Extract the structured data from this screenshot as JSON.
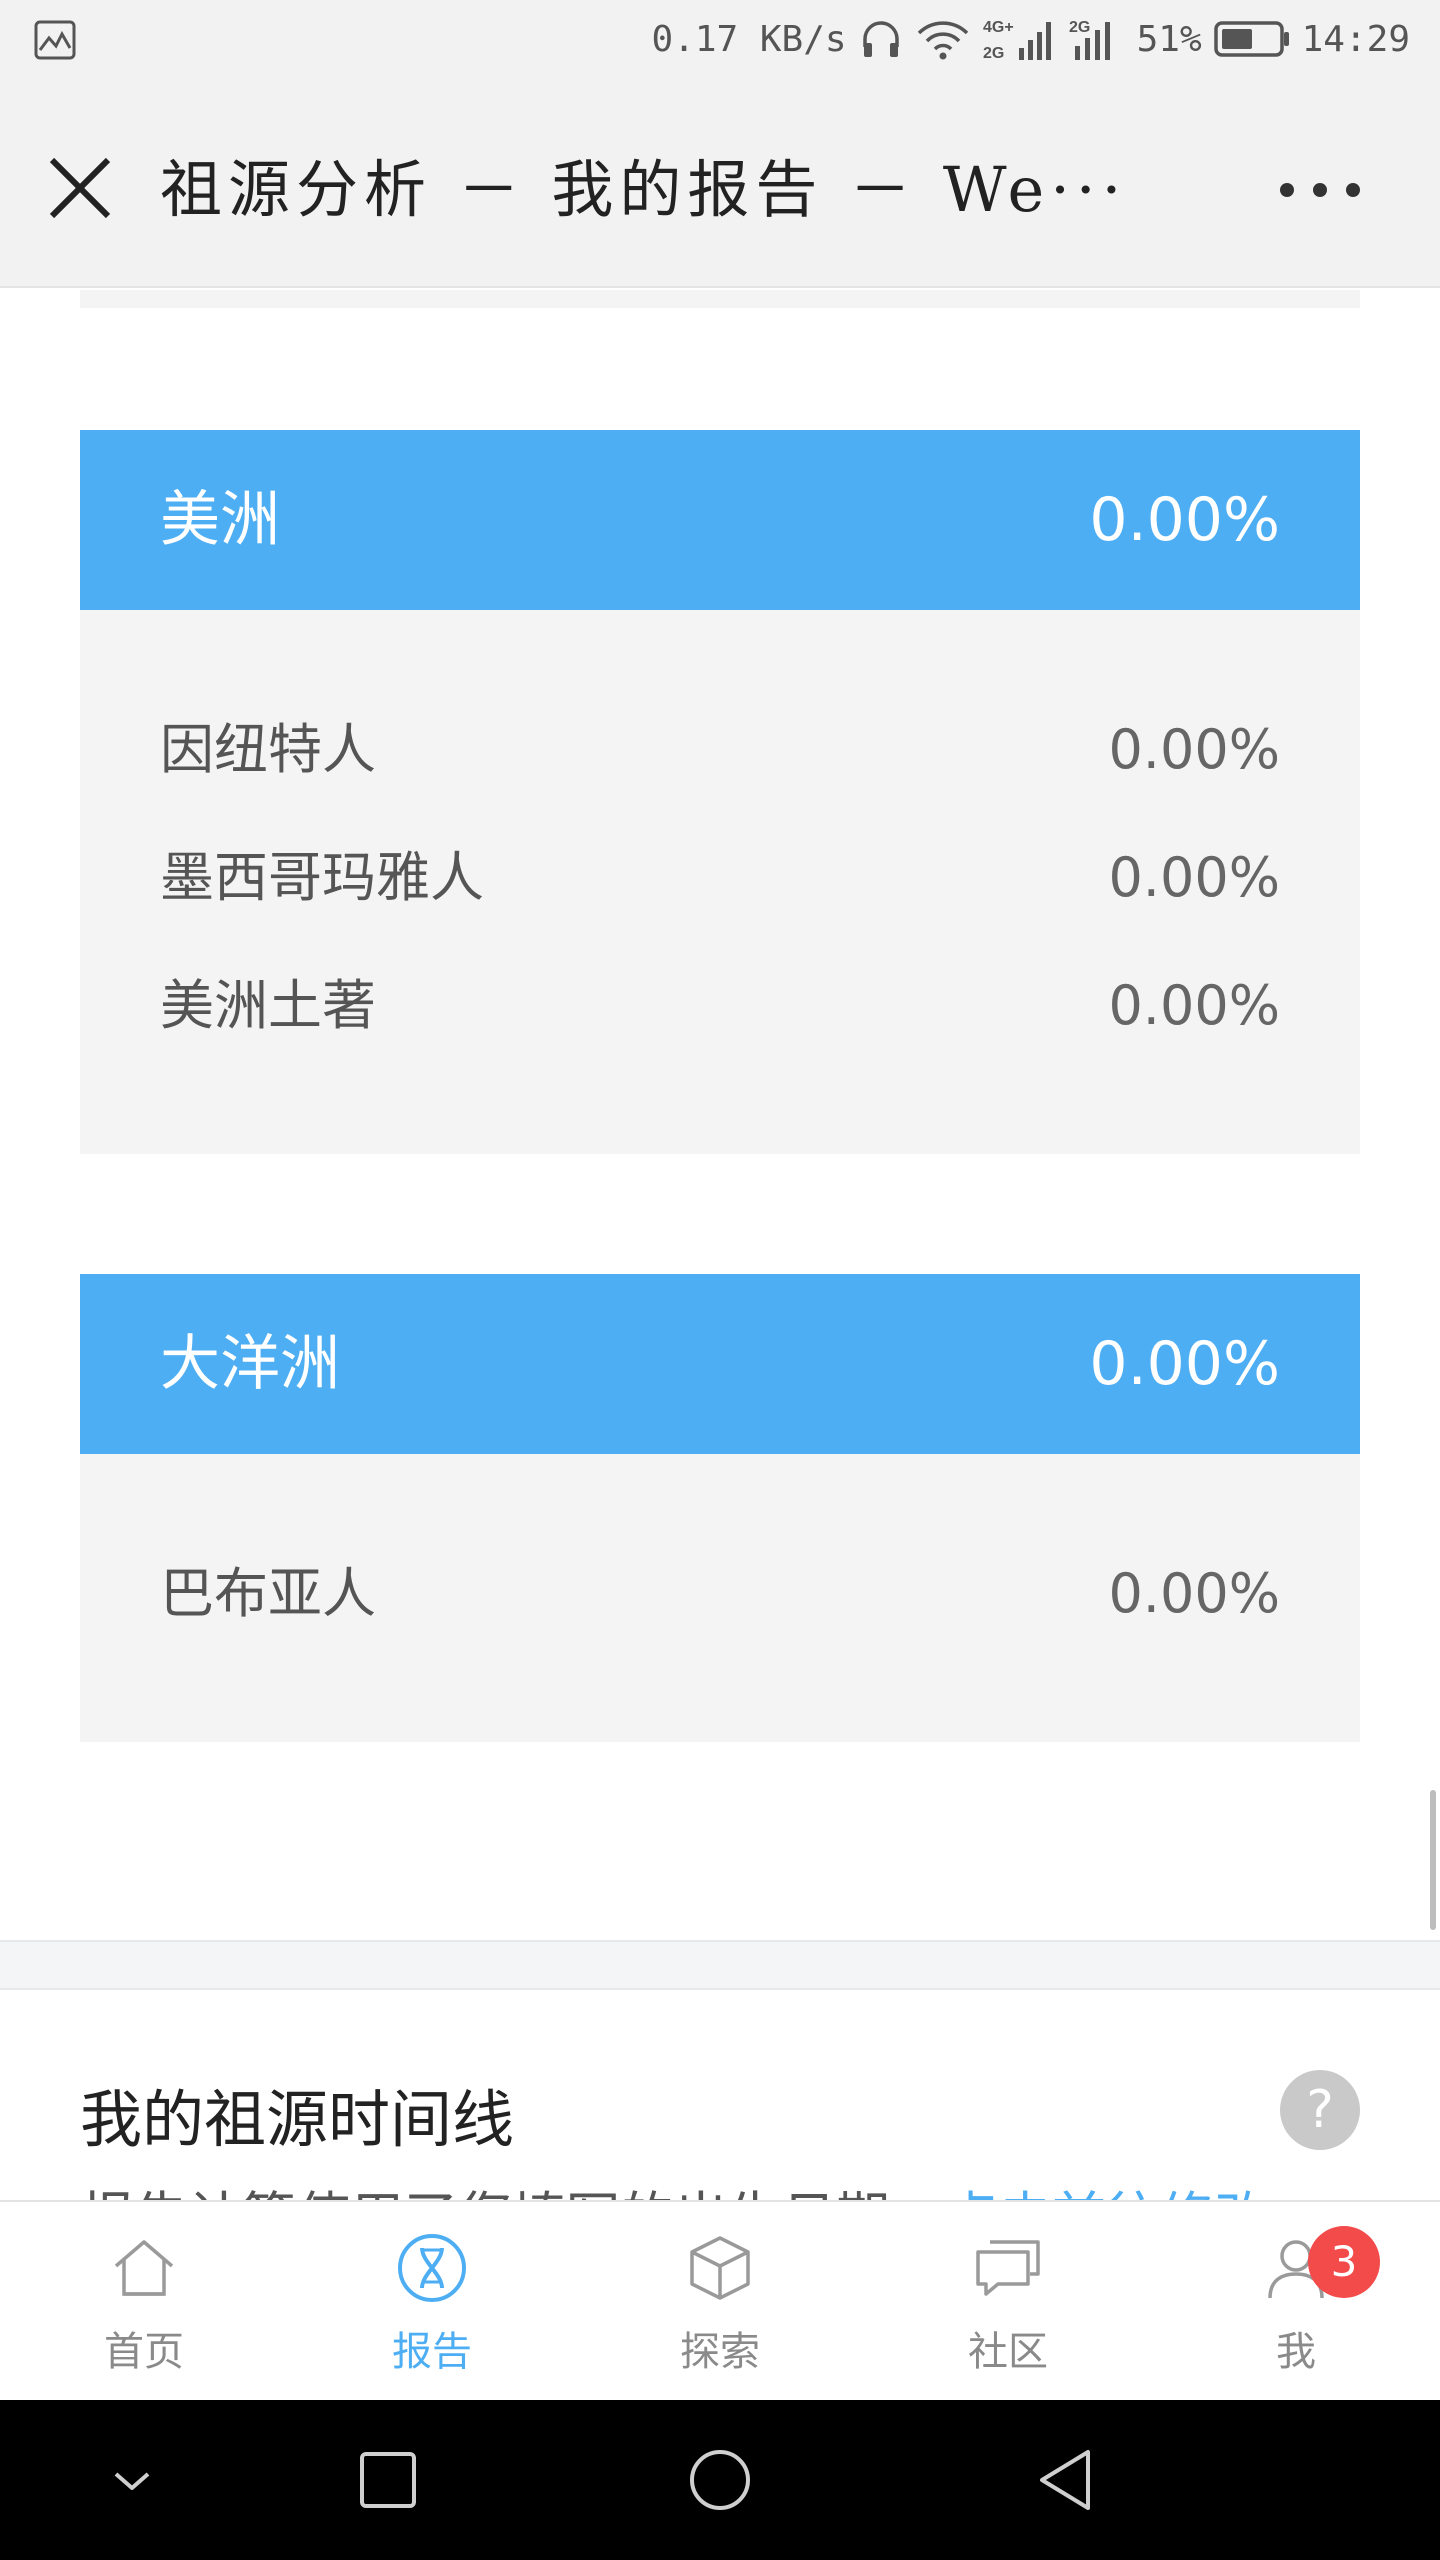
{
  "status_bar": {
    "speed": "0.17 KB/s",
    "net1": "4G+",
    "net2": "2G",
    "net3": "2G",
    "battery": "51%",
    "time": "14:29"
  },
  "header": {
    "title": "祖源分析 － 我的报告 － We···"
  },
  "regions": [
    {
      "name": "美洲",
      "percent": "0.00%",
      "items": [
        {
          "name": "因纽特人",
          "percent": "0.00%"
        },
        {
          "name": "墨西哥玛雅人",
          "percent": "0.00%"
        },
        {
          "name": "美洲土著",
          "percent": "0.00%"
        }
      ]
    },
    {
      "name": "大洋洲",
      "percent": "0.00%",
      "items": [
        {
          "name": "巴布亚人",
          "percent": "0.00%"
        }
      ]
    }
  ],
  "timeline": {
    "title": "我的祖源时间线",
    "help": "?",
    "subtitle": "报告计算使用了您填写的出生日期，",
    "link": "点击前往修改"
  },
  "tabs": [
    {
      "label": "首页",
      "icon": "home-icon"
    },
    {
      "label": "报告",
      "icon": "dna-icon",
      "active": true
    },
    {
      "label": "探索",
      "icon": "cube-icon"
    },
    {
      "label": "社区",
      "icon": "chat-icon"
    },
    {
      "label": "我",
      "icon": "user-icon",
      "badge": "3"
    }
  ],
  "colors": {
    "accent": "#4eaef3",
    "badge": "#f34a4a",
    "card_bg": "#f4f4f4"
  }
}
